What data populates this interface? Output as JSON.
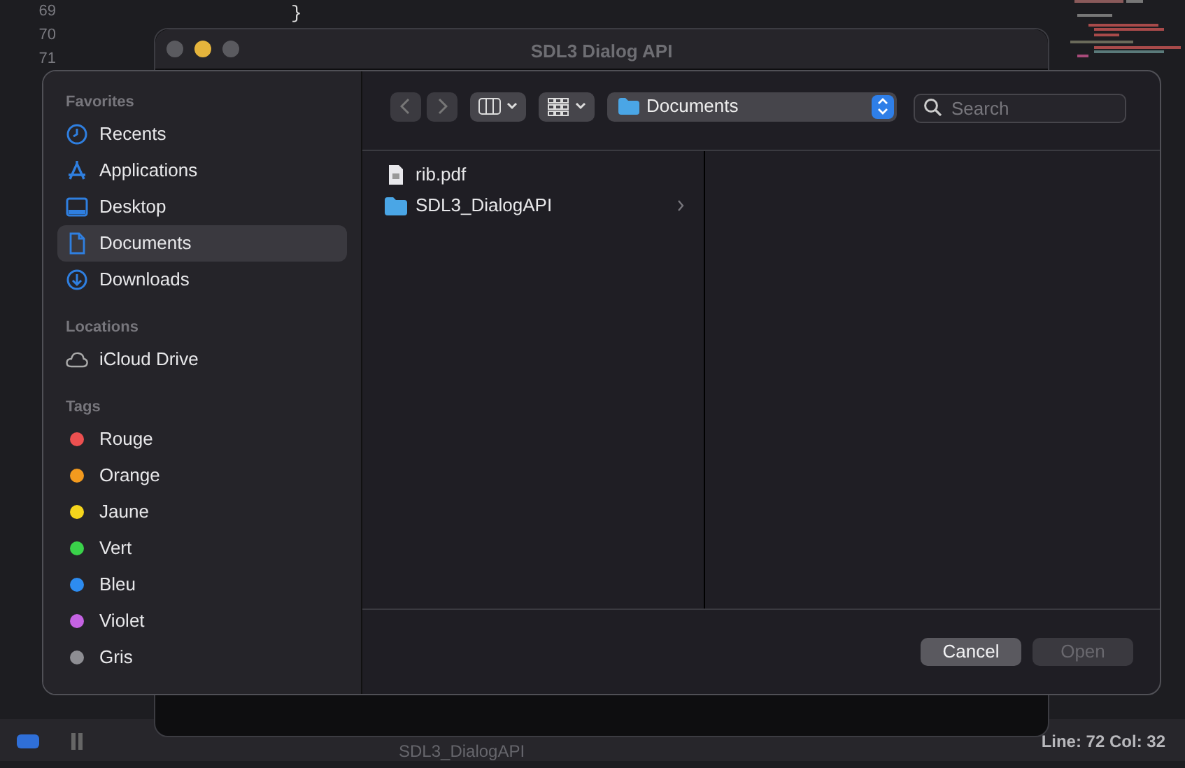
{
  "editor": {
    "line_numbers": [
      "69",
      "70",
      "71"
    ],
    "code_line": "}",
    "status": {
      "file": "SDL3_DialogAPI",
      "position": "Line: 72 Col: 32"
    }
  },
  "window": {
    "title": "SDL3 Dialog API",
    "traffic_lights": [
      {
        "color": "#5a5a5f"
      },
      {
        "color": "#e5b43c"
      },
      {
        "color": "#5a5a5f"
      }
    ]
  },
  "dialog": {
    "sidebar": [
      {
        "heading": "Favorites",
        "items": [
          {
            "label": "Recents",
            "kind": "clock",
            "selected": false
          },
          {
            "label": "Applications",
            "kind": "apps",
            "selected": false
          },
          {
            "label": "Desktop",
            "kind": "desktop",
            "selected": false
          },
          {
            "label": "Documents",
            "kind": "document",
            "selected": true
          },
          {
            "label": "Downloads",
            "kind": "download",
            "selected": false
          }
        ]
      },
      {
        "heading": "Locations",
        "items": [
          {
            "label": "iCloud Drive",
            "kind": "cloud",
            "selected": false
          }
        ]
      },
      {
        "heading": "Tags",
        "items": [
          {
            "label": "Rouge",
            "kind": "tag",
            "color": "#ec5050",
            "selected": false
          },
          {
            "label": "Orange",
            "kind": "tag",
            "color": "#f39a1e",
            "selected": false
          },
          {
            "label": "Jaune",
            "kind": "tag",
            "color": "#f5d51c",
            "selected": false
          },
          {
            "label": "Vert",
            "kind": "tag",
            "color": "#3ad24a",
            "selected": false
          },
          {
            "label": "Bleu",
            "kind": "tag",
            "color": "#2d8cf0",
            "selected": false
          },
          {
            "label": "Violet",
            "kind": "tag",
            "color": "#c563e3",
            "selected": false
          },
          {
            "label": "Gris",
            "kind": "tag",
            "color": "#8e8e93",
            "selected": false
          }
        ]
      }
    ],
    "toolbar": {
      "location": "Documents",
      "search": {
        "placeholder": "Search"
      }
    },
    "files": [
      {
        "name": "rib.pdf",
        "kind": "pdf"
      },
      {
        "name": "SDL3_DialogAPI",
        "kind": "folder"
      }
    ],
    "buttons": [
      {
        "label": "Cancel",
        "disabled": false
      },
      {
        "label": "Open",
        "disabled": true
      }
    ]
  }
}
